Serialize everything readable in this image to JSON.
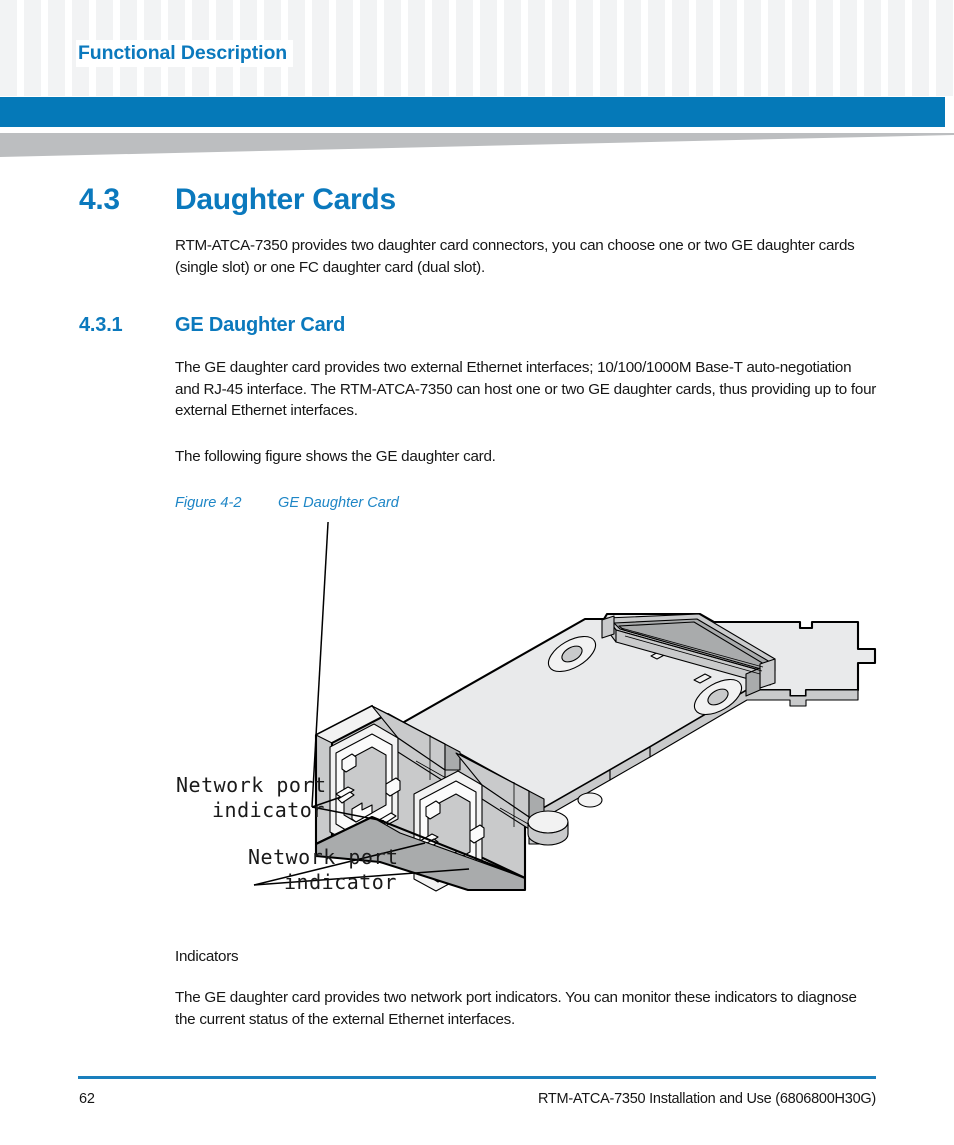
{
  "header": {
    "running_title": "Functional Description",
    "accent_color": "#0579b8",
    "pattern_color": "#f2f3f4",
    "wedge_color": "#bcbec0"
  },
  "sections": {
    "main": {
      "number": "4.3",
      "title": "Daughter Cards",
      "intro": "RTM-ATCA-7350 provides two daughter card connectors, you can choose one or two GE daughter cards (single slot) or one FC daughter card (dual slot)."
    },
    "sub": {
      "number": "4.3.1",
      "title": "GE Daughter Card",
      "paragraph_1": "The GE daughter card provides two external Ethernet interfaces; 10/100/1000M Base-T auto-negotiation and RJ-45 interface. The RTM-ATCA-7350 can host one or two GE daughter cards, thus providing up to four external Ethernet interfaces.",
      "paragraph_2": "The following figure shows the GE daughter card."
    }
  },
  "figure": {
    "label": "Figure 4-2",
    "caption": "GE Daughter Card",
    "callouts": [
      {
        "line_1": "Network port",
        "line_2": "indicator"
      },
      {
        "line_1": "Network port",
        "line_2": "indicator"
      }
    ]
  },
  "indicators": {
    "heading": "Indicators",
    "body": "The GE daughter card provides two network port indicators. You can monitor these indicators to diagnose the current status of the external Ethernet interfaces."
  },
  "footer": {
    "page_number": "62",
    "document_title": "RTM-ATCA-7350 Installation and Use (6806800H30G)",
    "rule_color": "#1a7fbd"
  }
}
